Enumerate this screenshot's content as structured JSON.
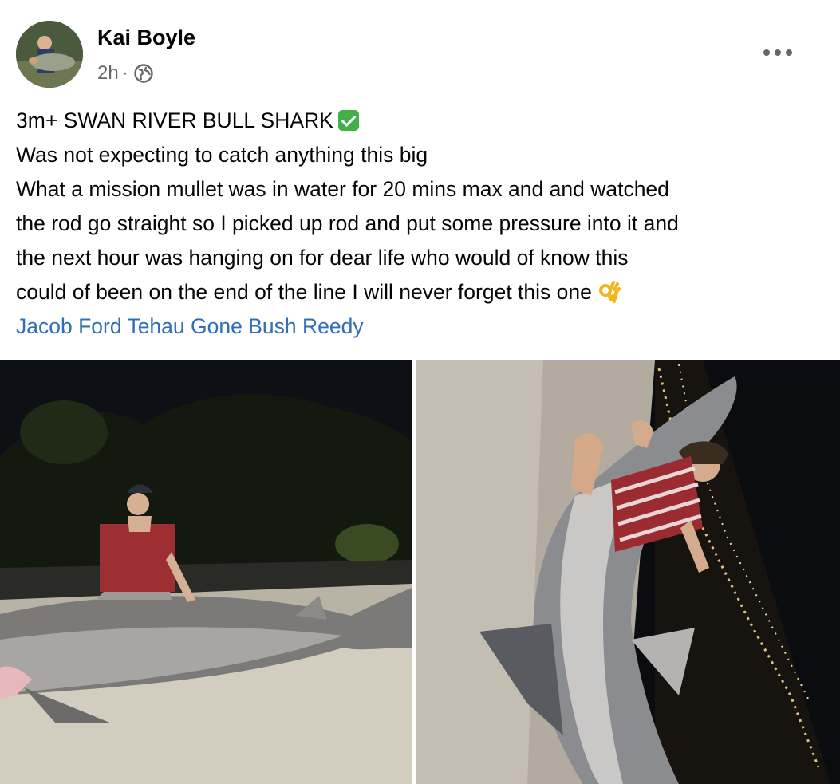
{
  "post": {
    "author": "Kai Boyle",
    "time": "2h",
    "separator": "·",
    "privacy_icon": "globe-icon",
    "more_icon": "more-options-icon"
  },
  "text": {
    "line1": "3m+ SWAN RIVER BULL SHARK",
    "line1_emoji": "check-mark-button-emoji",
    "line2": "Was not expecting to catch anything this big",
    "line3": "What a mission mullet was in water for 20 mins max and and watched",
    "line4": "the rod go straight so I picked up rod and put some pressure into it and",
    "line5": "the next hour was hanging on for dear life who would of know this",
    "line6": "could of been on the end of the line I will never forget this one",
    "line6_emoji": "ok-hand-emoji",
    "tags": "Jacob Ford Tehau Gone Bush Reedy"
  },
  "colors": {
    "link": "#2f6fb7",
    "secondary_text": "#65676b",
    "check_green": "#43b047"
  }
}
